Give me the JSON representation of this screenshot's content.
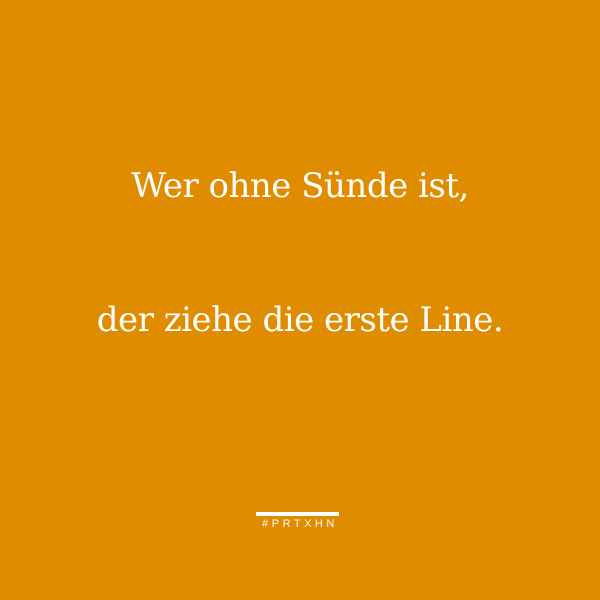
{
  "quote": {
    "line1": "Wer ohne Sünde ist,",
    "line2": "der ziehe die erste Line."
  },
  "tag": "#PRTXHN",
  "colors": {
    "background": "#e08c00",
    "text": "#ffffff"
  }
}
